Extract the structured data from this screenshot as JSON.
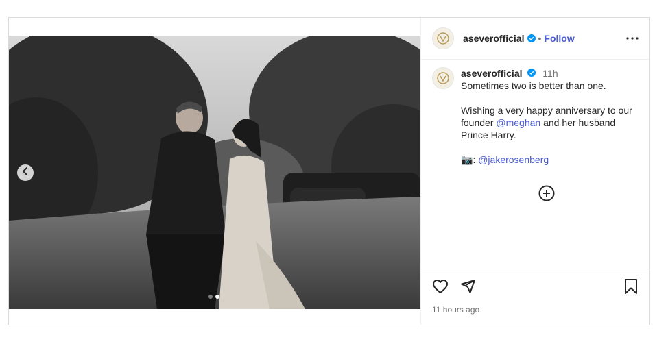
{
  "post": {
    "header": {
      "username": "aseverofficial",
      "separator": "•",
      "follow_label": "Follow"
    },
    "caption": {
      "username": "aseverofficial",
      "time": "11h",
      "lines": [
        "Sometimes two is better than one.",
        "",
        "Wishing a very happy anniversary to our"
      ],
      "founder_prefix": "founder ",
      "founder_mention": "@meghan",
      "founder_suffix": " and her husband",
      "line_prince": "Prince Harry.",
      "camera_emoji": "📷",
      "credit_colon": ": ",
      "credit_mention": "@jakerosenberg"
    },
    "footer": {
      "timestamp": "11 hours ago"
    },
    "carousel": {
      "slide_count": 2,
      "active_index": 1
    },
    "colors": {
      "link": "#4a5bd4",
      "verified": "#0095f6",
      "muted": "#737373",
      "border": "#dbdbdb"
    },
    "icons": [
      "verified-badge-icon",
      "more-options-icon",
      "chevron-left-icon",
      "plus-circle-icon",
      "heart-icon",
      "share-icon",
      "bookmark-icon"
    ]
  }
}
